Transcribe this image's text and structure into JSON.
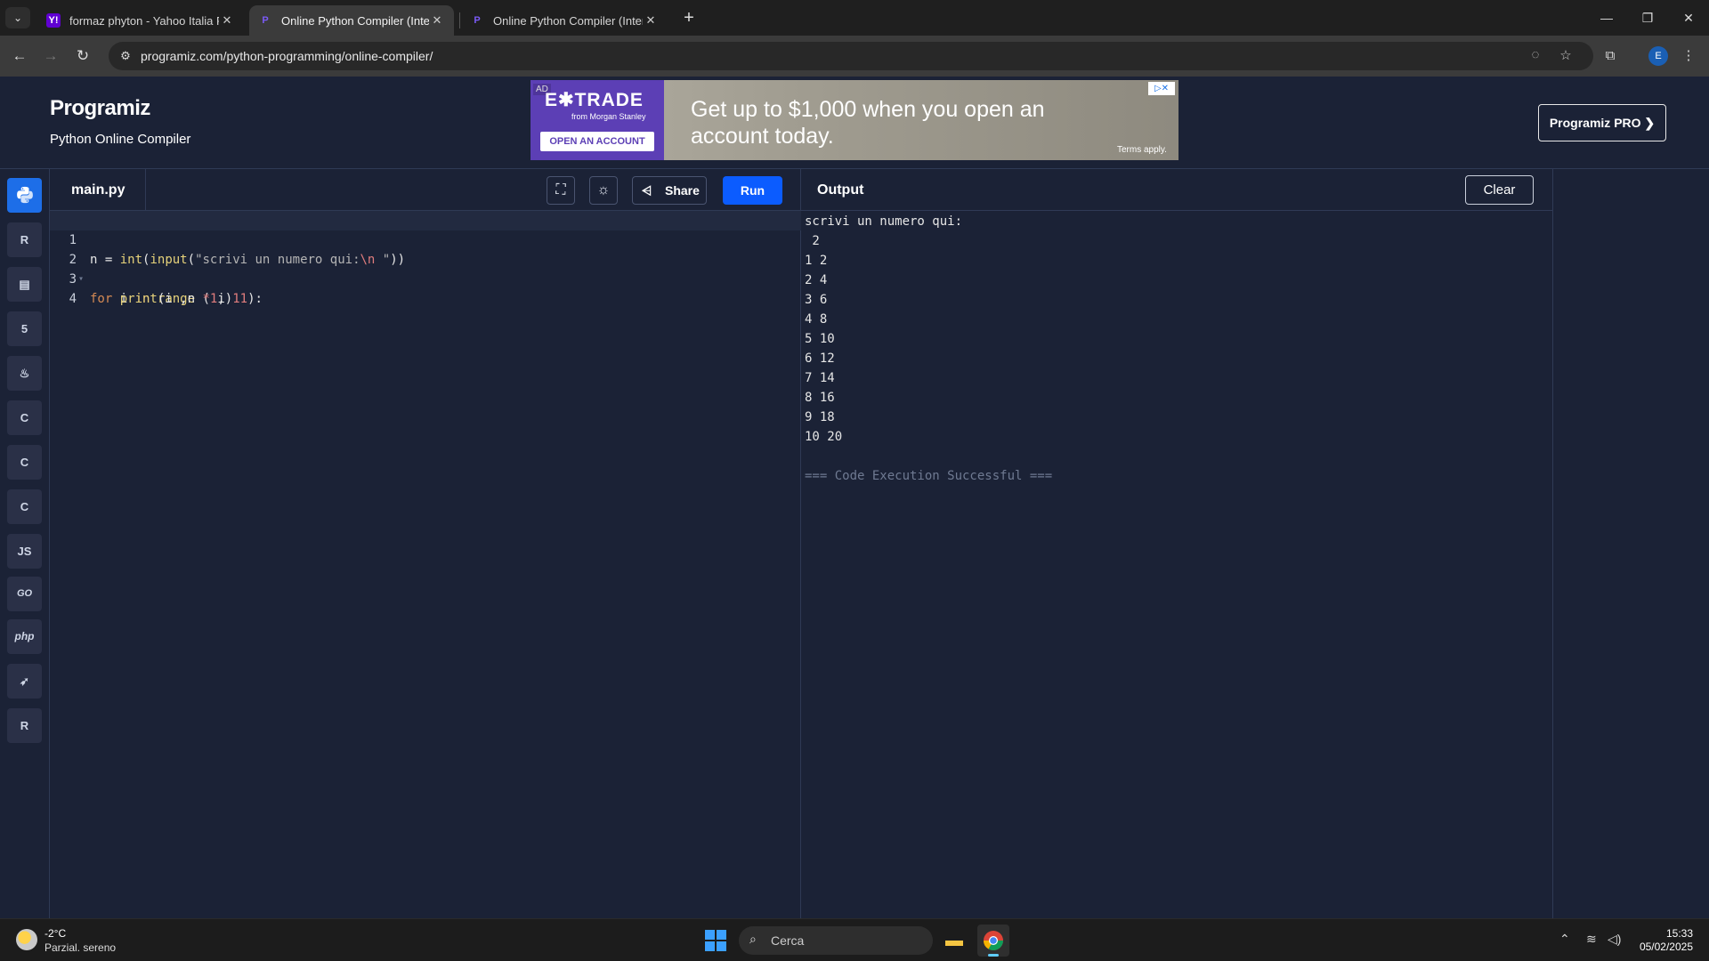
{
  "browser": {
    "tabs": [
      {
        "title": "formaz phyton - Yahoo Italia Ri",
        "favicon": "yahoo-icon"
      },
      {
        "title": "Online Python Compiler (Interp",
        "favicon": "programiz-icon",
        "active": true
      },
      {
        "title": "Online Python Compiler (Interp",
        "favicon": "programiz-icon"
      }
    ],
    "url": "programiz.com/python-programming/online-compiler/",
    "profile_initial": "E",
    "accent": "#1a5fb4"
  },
  "site": {
    "logo": "Programiz",
    "subtitle": "Python Online Compiler",
    "pro_button": "Programiz PRO ❯"
  },
  "ad": {
    "tag": "AD",
    "brand": "E✱TRADE",
    "brand_sub": "from Morgan Stanley",
    "cta": "OPEN AN ACCOUNT",
    "headline": "Get up to $1,000 when you open an account today.",
    "terms": "Terms apply."
  },
  "rail": {
    "languages": [
      {
        "name": "python-icon",
        "label": "",
        "active": true
      },
      {
        "name": "r-icon",
        "label": "R"
      },
      {
        "name": "sql-icon",
        "label": "▤"
      },
      {
        "name": "html-icon",
        "label": "5"
      },
      {
        "name": "java-icon",
        "label": "♨"
      },
      {
        "name": "c-icon",
        "label": "C"
      },
      {
        "name": "cpp-icon",
        "label": "C"
      },
      {
        "name": "csharp-icon",
        "label": "C"
      },
      {
        "name": "js-icon",
        "label": "JS"
      },
      {
        "name": "go-icon",
        "label": "GO"
      },
      {
        "name": "php-icon",
        "label": "php"
      },
      {
        "name": "swift-icon",
        "label": "➶"
      },
      {
        "name": "rust-icon",
        "label": "R"
      }
    ]
  },
  "editor": {
    "filename": "main.py",
    "share_label": "Share",
    "run_label": "Run",
    "line_numbers": [
      "1",
      "2",
      "3",
      "4"
    ]
  },
  "output": {
    "title": "Output",
    "clear_label": "Clear",
    "lines": [
      "scrivi un numero qui:",
      " 2",
      "1 2",
      "2 4",
      "3 6",
      "4 8",
      "5 10",
      "6 12",
      "7 14",
      "8 16",
      "9 18",
      "10 20",
      ""
    ],
    "status": "=== Code Execution Successful ==="
  },
  "taskbar": {
    "temperature": "-2°C",
    "weather": "Parzial. sereno",
    "search_placeholder": "Cerca",
    "time": "15:33",
    "date": "05/02/2025"
  }
}
